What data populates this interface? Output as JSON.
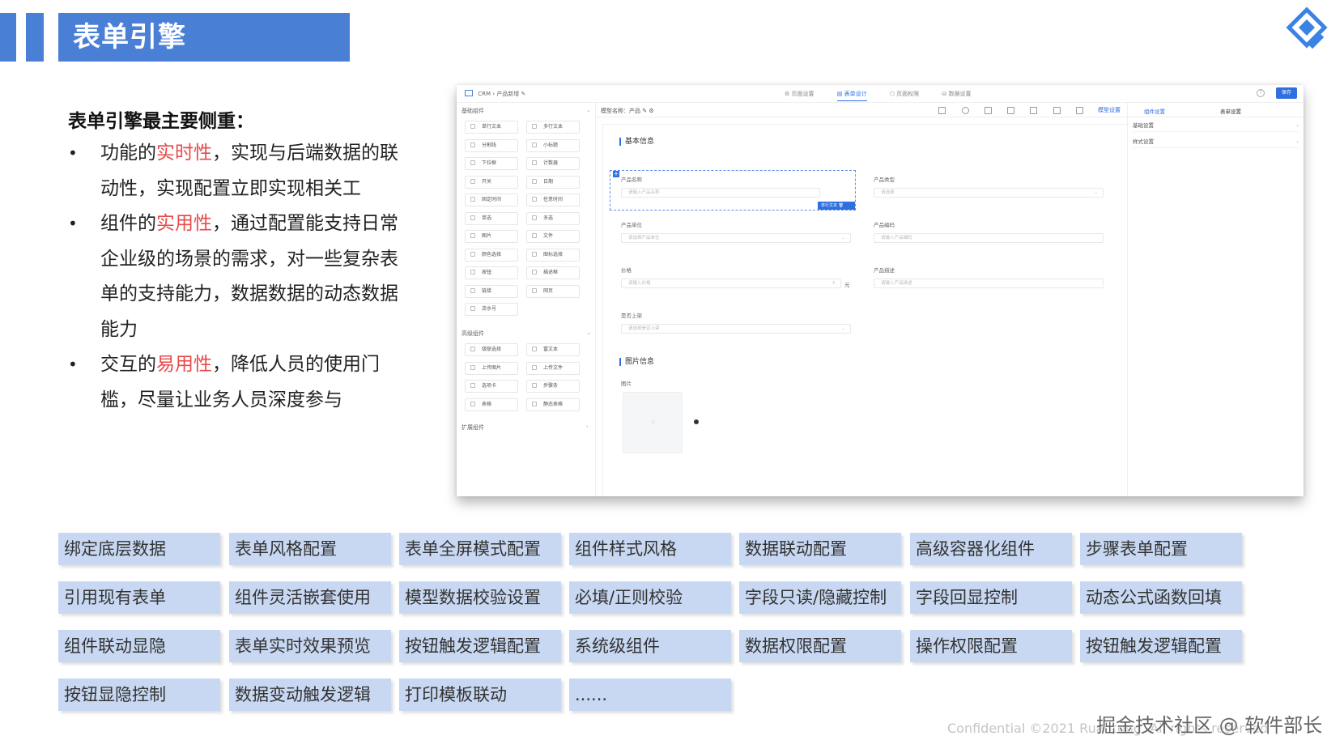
{
  "header": {
    "title": "表单引擎"
  },
  "intro": {
    "subtitle": "表单引擎最主要侧重：",
    "bullets": [
      {
        "dot": "•",
        "pre": "功能的",
        "hl": "实时性",
        "post": "，实现与后端数据的联动性，实现配置立即实现相关工"
      },
      {
        "dot": "•",
        "pre": "组件的",
        "hl": "实用性",
        "post": "，通过配置能支持日常企业级的场景的需求，对一些复杂表单的支持能力，数据数据的动态数据能力"
      },
      {
        "dot": "•",
        "pre": "交互的",
        "hl": "易用性",
        "post": "，降低人员的使用门槛，尽量让业务人员深度参与"
      }
    ]
  },
  "screenshot": {
    "breadcrumb": [
      "CRM",
      "›",
      "产品新增",
      "✎"
    ],
    "top_tabs": [
      "⚙ 页面设置",
      "▤ 表单设计",
      "⬡ 页面权限",
      "⛁ 数据设置"
    ],
    "active_tab": 1,
    "help": "?",
    "save_label": "保存",
    "basic_section": "基础组件",
    "advanced_section": "高级组件",
    "extend_section": "扩展组件",
    "basic_components": [
      "单行文本",
      "多行文本",
      "分割线",
      "小标题",
      "下拉框",
      "计数器",
      "开关",
      "日期",
      "固定时间",
      "任意时间",
      "单选",
      "多选",
      "图片",
      "文件",
      "颜色选择",
      "图标选择",
      "按钮",
      "描述框",
      "链接",
      "网页",
      "流水号"
    ],
    "advanced_components": [
      "级联选择",
      "富文本",
      "上传图片",
      "上传文件",
      "选项卡",
      "步骤条",
      "表格",
      "静态表格"
    ],
    "model_name": "模型名称：产品 ✎ ⚙",
    "toolbar_link": "模型设置",
    "group_basic": "基本信息",
    "group_image": "图片信息",
    "fields": {
      "name_label": "产品名称",
      "name_ph": "请输入产品名称",
      "type_label": "产品类型",
      "type_ph": "请选择",
      "unit_label": "产品单位",
      "unit_ph": "请选择产品单位",
      "code_label": "产品编码",
      "code_ph": "请输入产品编码",
      "price_label": "价格",
      "price_ph": "请输入价格",
      "price_unit": "元",
      "desc_label": "产品描述",
      "desc_ph": "请输入产品描述",
      "onsale_label": "是否上架",
      "onsale_ph": "请选择是否上架",
      "image_label": "图片"
    },
    "selected_tag": "单行文本 🗑",
    "right_tabs": [
      "组件设置",
      "表单设置"
    ],
    "right_rows": [
      "基础设置",
      "样式设置"
    ]
  },
  "features": [
    [
      "绑定底层数据",
      "表单风格配置",
      "表单全屏模式配置",
      "组件样式风格",
      "数据联动配置",
      "高级容器化组件",
      "步骤表单配置"
    ],
    [
      "引用现有表单",
      "组件灵活嵌套使用",
      "模型数据校验设置",
      "必填/正则校验",
      "字段只读/隐藏控制",
      "字段回显控制",
      "动态公式函数回填"
    ],
    [
      "组件联动显隐",
      "表单实时效果预览",
      "按钮触发逻辑配置",
      "系统级组件",
      "数据权限配置",
      "操作权限配置",
      "按钮触发逻辑配置"
    ],
    [
      "按钮显隐控制",
      "数据变动触发逻辑",
      "打印模板联动",
      "......"
    ]
  ],
  "footer": "Confidential ©2021 Ruantong. All rights reserved",
  "watermark": "掘金技术社区 @ 软件部长",
  "colors": {
    "accent": "#4a7fd6",
    "highlight": "#e84a4a",
    "tag_bg": "#c8d8f2"
  }
}
